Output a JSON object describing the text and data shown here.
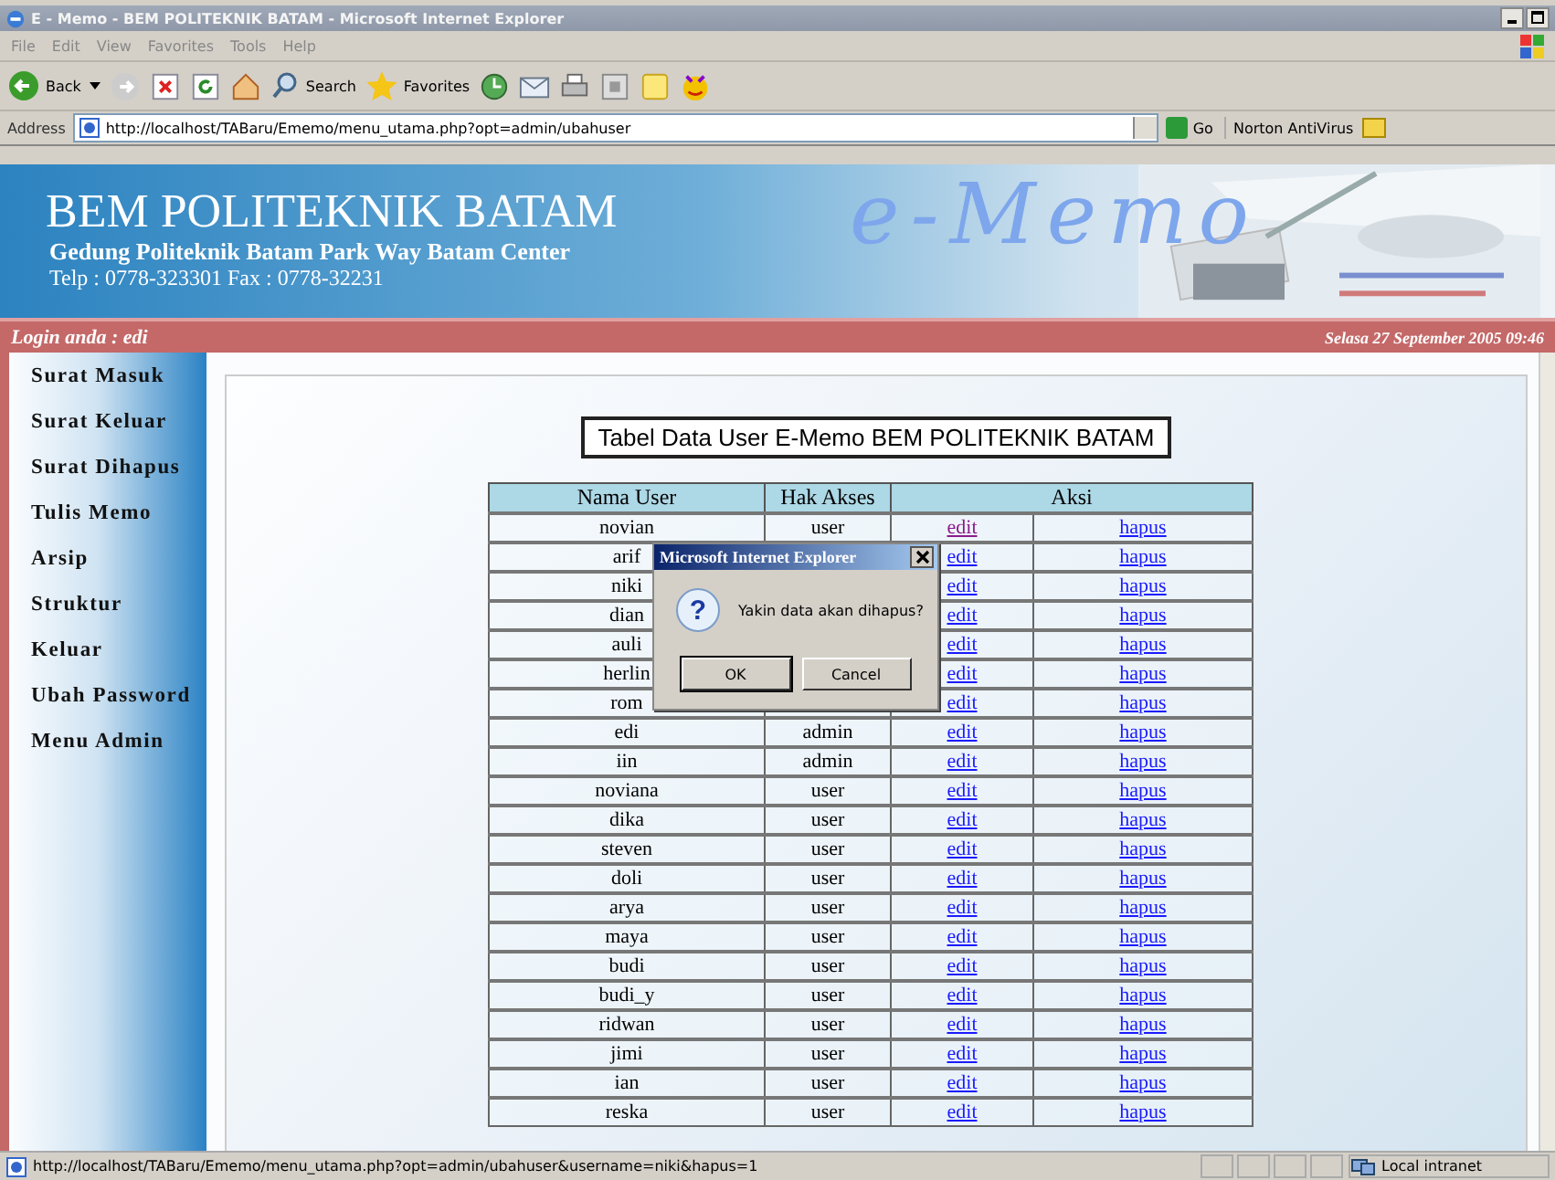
{
  "window": {
    "title": "E - Memo - BEM POLITEKNIK BATAM - Microsoft Internet Explorer"
  },
  "menu": [
    "File",
    "Edit",
    "View",
    "Favorites",
    "Tools",
    "Help"
  ],
  "toolbar": {
    "back": "Back",
    "search": "Search",
    "favorites": "Favorites"
  },
  "address": {
    "label": "Address",
    "url": "http://localhost/TABaru/Ememo/menu_utama.php?opt=admin/ubahuser",
    "go": "Go",
    "extra": "Norton AntiVirus"
  },
  "header": {
    "title": "BEM POLITEKNIK BATAM",
    "address": "Gedung Politeknik Batam Park Way Batam Center",
    "contact": "Telp : 0778-323301 Fax : 0778-32231",
    "logo": "e-Memo"
  },
  "info_bar": {
    "login": "Login anda : edi",
    "datetime": "Selasa 27 September 2005 09:46"
  },
  "sidebar": {
    "items": [
      "Surat Masuk",
      "Surat Keluar",
      "Surat Dihapus",
      "Tulis Memo",
      "Arsip",
      "Struktur",
      "Keluar",
      "Ubah Password",
      "Menu Admin"
    ]
  },
  "table": {
    "title": "Tabel Data User E-Memo BEM POLITEKNIK BATAM",
    "columns": [
      "Nama User",
      "Hak Akses",
      "Aksi"
    ],
    "rows": [
      {
        "name": "novian",
        "access": "user",
        "edit": "edit",
        "visited": true,
        "delete": "hapus"
      },
      {
        "name": "arif",
        "edit": "edit",
        "visited": false,
        "delete": "hapus"
      },
      {
        "name": "niki",
        "edit": "edit",
        "visited": false,
        "delete": "hapus"
      },
      {
        "name": "dian",
        "edit": "edit",
        "visited": false,
        "delete": "hapus"
      },
      {
        "name": "auli",
        "edit": "edit",
        "visited": false,
        "delete": "hapus"
      },
      {
        "name": "herlin",
        "edit": "edit",
        "visited": false,
        "delete": "hapus"
      },
      {
        "name": "rom",
        "edit": "edit",
        "visited": false,
        "delete": "hapus"
      },
      {
        "name": "edi",
        "access": "admin",
        "edit": "edit",
        "visited": false,
        "delete": "hapus"
      },
      {
        "name": "iin",
        "access": "admin",
        "edit": "edit",
        "visited": false,
        "delete": "hapus"
      },
      {
        "name": "noviana",
        "access": "user",
        "edit": "edit",
        "visited": false,
        "delete": "hapus"
      },
      {
        "name": "dika",
        "access": "user",
        "edit": "edit",
        "visited": false,
        "delete": "hapus"
      },
      {
        "name": "steven",
        "access": "user",
        "edit": "edit",
        "visited": false,
        "delete": "hapus"
      },
      {
        "name": "doli",
        "access": "user",
        "edit": "edit",
        "visited": false,
        "delete": "hapus"
      },
      {
        "name": "arya",
        "access": "user",
        "edit": "edit",
        "visited": false,
        "delete": "hapus"
      },
      {
        "name": "maya",
        "access": "user",
        "edit": "edit",
        "visited": false,
        "delete": "hapus"
      },
      {
        "name": "budi",
        "access": "user",
        "edit": "edit",
        "visited": false,
        "delete": "hapus"
      },
      {
        "name": "budi_y",
        "access": "user",
        "edit": "edit",
        "visited": false,
        "delete": "hapus"
      },
      {
        "name": "ridwan",
        "access": "user",
        "edit": "edit",
        "visited": false,
        "delete": "hapus"
      },
      {
        "name": "jimi",
        "access": "user",
        "edit": "edit",
        "visited": false,
        "delete": "hapus"
      },
      {
        "name": "ian",
        "access": "user",
        "edit": "edit",
        "visited": false,
        "delete": "hapus"
      },
      {
        "name": "reska",
        "access": "user",
        "edit": "edit",
        "visited": false,
        "delete": "hapus"
      }
    ]
  },
  "dialog": {
    "title": "Microsoft Internet Explorer",
    "icon": "?",
    "message": "Yakin data akan dihapus?",
    "buttons": [
      "OK",
      "Cancel"
    ]
  },
  "status_bar": {
    "text": "http://localhost/TABaru/Ememo/menu_utama.php?opt=admin/ubahuser&username=niki&hapus=1",
    "zone": "Local intranet"
  }
}
